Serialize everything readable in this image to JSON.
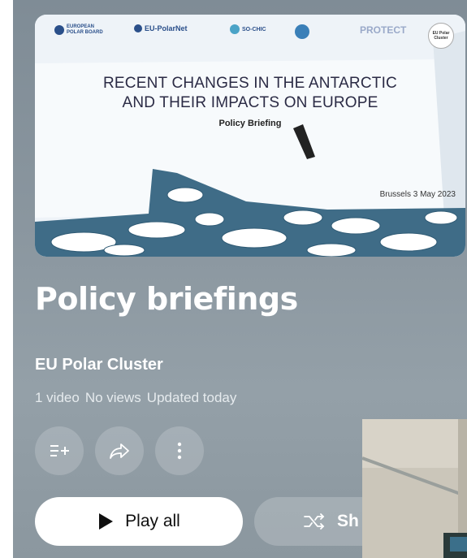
{
  "thumbnail": {
    "title_line1": "RECENT CHANGES IN THE ANTARCTIC",
    "title_line2": "AND THEIR IMPACTS ON EUROPE",
    "subtitle": "Policy Briefing",
    "place_date": "Brussels 3 May 2023",
    "logos": [
      "EUROPEAN POLAR BOARD",
      "EU-PolarNet",
      "SO-CHIC",
      "PROTECT",
      "EU Polar Cluster"
    ]
  },
  "playlist": {
    "title": "Policy briefings",
    "channel": "EU Polar Cluster",
    "video_count": "1 video",
    "views": "No views",
    "updated": "Updated today"
  },
  "actions": {
    "play_all": "Play all",
    "shuffle": "Sh"
  },
  "colors": {
    "panel": "#8a969f",
    "accent_white": "#ffffff",
    "logo_blue": "#2a4f8a"
  }
}
